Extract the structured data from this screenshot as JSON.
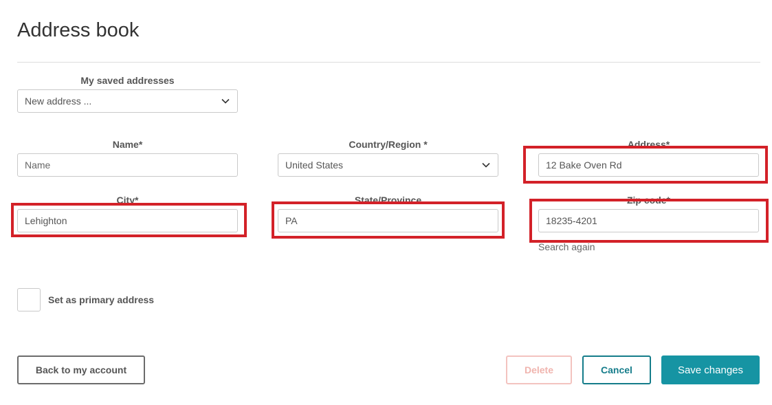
{
  "page": {
    "title": "Address book"
  },
  "saved": {
    "label": "My saved addresses",
    "value": "New address ..."
  },
  "form": {
    "name": {
      "label": "Name*",
      "placeholder": "Name"
    },
    "country": {
      "label": "Country/Region *",
      "value": "United States"
    },
    "address": {
      "label": "Address*",
      "value": "12 Bake Oven Rd"
    },
    "city": {
      "label": "City*",
      "value": "Lehighton"
    },
    "state": {
      "label": "State/Province",
      "value": "PA"
    },
    "zip": {
      "label": "Zip code*",
      "value": "18235-4201"
    },
    "search_again": "Search again",
    "primary_label": "Set as primary address"
  },
  "buttons": {
    "back": "Back to my account",
    "delete": "Delete",
    "cancel": "Cancel",
    "save": "Save changes"
  },
  "colors": {
    "highlight": "#d32128",
    "accent": "#1694a3",
    "cancel": "#147c8a",
    "delete_disabled": "#f0b4ae"
  },
  "icons": {
    "dropdown": "chevron-down-icon"
  }
}
